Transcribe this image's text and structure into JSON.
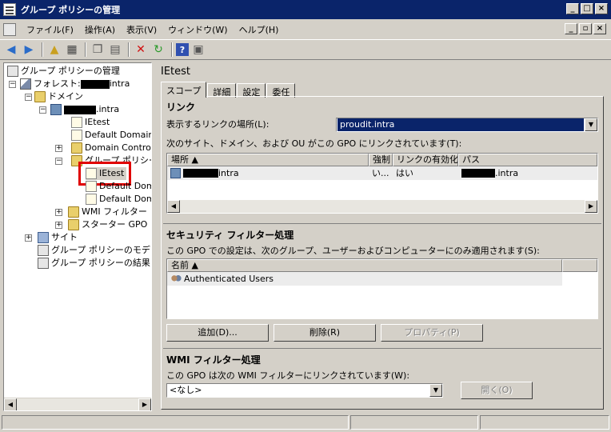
{
  "window": {
    "title": "グループ ポリシーの管理"
  },
  "menu": [
    "ファイル(F)",
    "操作(A)",
    "表示(V)",
    "ウィンドウ(W)",
    "ヘルプ(H)"
  ],
  "tree": {
    "root": "グループ ポリシーの管理",
    "forest_prefix": "フォレスト:",
    "forest_suffix": "intra",
    "domains": "ドメイン",
    "domain_suffix": ".intra",
    "ietest_top": "IEtest",
    "default_domain": "Default Domain",
    "domain_controllers": "Domain Controll",
    "gpo_objects": "グループ ポリシー",
    "ietest_selected": "IEtest",
    "default_dom_1": "Default Dom",
    "default_dom_2": "Default Dom",
    "wmi_filters": "WMI フィルター",
    "starter_gpo": "スターター GPO",
    "sites": "サイト",
    "modeling": "グループ ポリシーのモデリ",
    "results": "グループ ポリシーの結果"
  },
  "right": {
    "title": "IEtest",
    "tabs": [
      "スコープ",
      "詳細",
      "設定",
      "委任"
    ],
    "links": {
      "section_title": "リンク",
      "location_label": "表示するリンクの場所(L):",
      "location_value": "proudit.intra",
      "description": "次のサイト、ドメイン、および OU がこの GPO にリンクされています(T):",
      "columns": [
        "場所",
        "強制",
        "リンクの有効化",
        "パス"
      ],
      "rows": [
        {
          "location_suffix": "intra",
          "enforced": "い...",
          "enabled": "はい",
          "path_suffix": ".intra"
        }
      ]
    },
    "security": {
      "section_title": "セキュリティ フィルター処理",
      "description": "この GPO での設定は、次のグループ、ユーザーおよびコンピューターにのみ適用されます(S):",
      "column": "名前",
      "rows": [
        "Authenticated Users"
      ],
      "add_button": "追加(D)...",
      "delete_button": "削除(R)",
      "properties_button": "プロパティ(P)"
    },
    "wmi": {
      "section_title": "WMI フィルター処理",
      "description": "この GPO は次の WMI フィルターにリンクされています(W):",
      "value": "<なし>",
      "open_button": "開く(O)"
    }
  }
}
